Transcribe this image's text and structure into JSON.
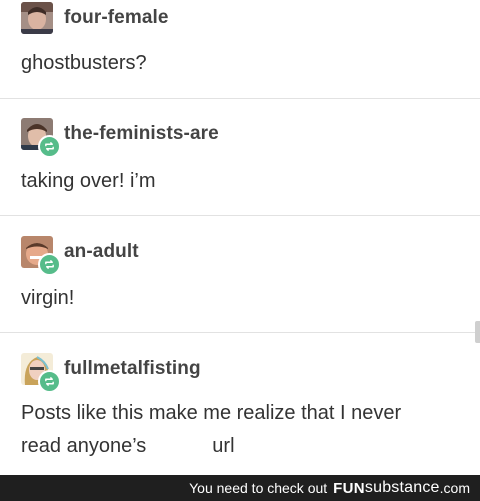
{
  "posts": [
    {
      "username": "four-female",
      "text": "ghostbusters?",
      "reblog": false,
      "avatar_icon": "user-avatar-icon"
    },
    {
      "username": "the-feminists-are",
      "text": "taking over! i’m",
      "reblog": true,
      "avatar_icon": "user-avatar-icon"
    },
    {
      "username": "an-adult",
      "text": "virgin!",
      "reblog": true,
      "avatar_icon": "user-avatar-icon"
    },
    {
      "username": "fullmetalfisting",
      "text_line1": "Posts like this make me realize that I never",
      "text_line2_a": "read anyone’s",
      "text_line2_b": "url",
      "reblog": true,
      "avatar_icon": "user-avatar-icon"
    }
  ],
  "icons": {
    "reblog": "reblog-icon"
  },
  "footer": {
    "prefix": "You need to check out",
    "brand_bold": "FUN",
    "brand_regular": "substance",
    "brand_tld": ".com"
  },
  "colors": {
    "reblog_badge": "#56bc8a",
    "footer_bg": "#1f1f1f"
  }
}
